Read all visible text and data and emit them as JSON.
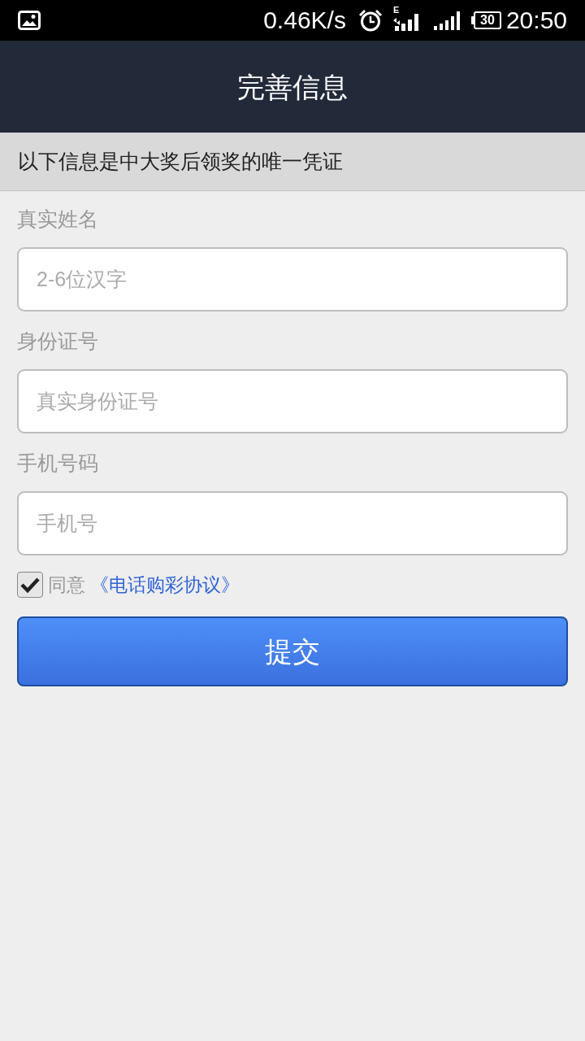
{
  "status_bar": {
    "speed": "0.46K/s",
    "network_type": "E",
    "battery": "30",
    "time": "20:50"
  },
  "header": {
    "title": "完善信息"
  },
  "notice": "以下信息是中大奖后领奖的唯一凭证",
  "fields": [
    {
      "label": "真实姓名",
      "placeholder": "2-6位汉字"
    },
    {
      "label": "身份证号",
      "placeholder": "真实身份证号"
    },
    {
      "label": "手机号码",
      "placeholder": "手机号"
    }
  ],
  "agreement": {
    "checked": true,
    "text": "同意",
    "link": "《电话购彩协议》"
  },
  "submit_button": "提交"
}
